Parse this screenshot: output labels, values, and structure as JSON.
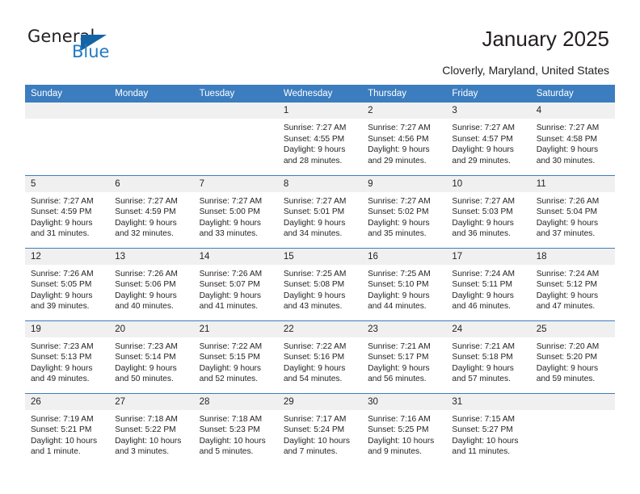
{
  "logo": {
    "word1": "General",
    "word2": "Blue",
    "triangle_color": "#1464a5",
    "blue_color": "#1f7ac4"
  },
  "header": {
    "title": "January 2025",
    "subtitle": "Cloverly, Maryland, United States"
  },
  "calendar": {
    "header_bg": "#3b7dbf",
    "daynum_bg": "#f0f0f0",
    "weekdays": [
      "Sunday",
      "Monday",
      "Tuesday",
      "Wednesday",
      "Thursday",
      "Friday",
      "Saturday"
    ],
    "weeks": [
      [
        {
          "day": "",
          "lines": []
        },
        {
          "day": "",
          "lines": []
        },
        {
          "day": "",
          "lines": []
        },
        {
          "day": "1",
          "lines": [
            "Sunrise: 7:27 AM",
            "Sunset: 4:55 PM",
            "Daylight: 9 hours",
            "and 28 minutes."
          ]
        },
        {
          "day": "2",
          "lines": [
            "Sunrise: 7:27 AM",
            "Sunset: 4:56 PM",
            "Daylight: 9 hours",
            "and 29 minutes."
          ]
        },
        {
          "day": "3",
          "lines": [
            "Sunrise: 7:27 AM",
            "Sunset: 4:57 PM",
            "Daylight: 9 hours",
            "and 29 minutes."
          ]
        },
        {
          "day": "4",
          "lines": [
            "Sunrise: 7:27 AM",
            "Sunset: 4:58 PM",
            "Daylight: 9 hours",
            "and 30 minutes."
          ]
        }
      ],
      [
        {
          "day": "5",
          "lines": [
            "Sunrise: 7:27 AM",
            "Sunset: 4:59 PM",
            "Daylight: 9 hours",
            "and 31 minutes."
          ]
        },
        {
          "day": "6",
          "lines": [
            "Sunrise: 7:27 AM",
            "Sunset: 4:59 PM",
            "Daylight: 9 hours",
            "and 32 minutes."
          ]
        },
        {
          "day": "7",
          "lines": [
            "Sunrise: 7:27 AM",
            "Sunset: 5:00 PM",
            "Daylight: 9 hours",
            "and 33 minutes."
          ]
        },
        {
          "day": "8",
          "lines": [
            "Sunrise: 7:27 AM",
            "Sunset: 5:01 PM",
            "Daylight: 9 hours",
            "and 34 minutes."
          ]
        },
        {
          "day": "9",
          "lines": [
            "Sunrise: 7:27 AM",
            "Sunset: 5:02 PM",
            "Daylight: 9 hours",
            "and 35 minutes."
          ]
        },
        {
          "day": "10",
          "lines": [
            "Sunrise: 7:27 AM",
            "Sunset: 5:03 PM",
            "Daylight: 9 hours",
            "and 36 minutes."
          ]
        },
        {
          "day": "11",
          "lines": [
            "Sunrise: 7:26 AM",
            "Sunset: 5:04 PM",
            "Daylight: 9 hours",
            "and 37 minutes."
          ]
        }
      ],
      [
        {
          "day": "12",
          "lines": [
            "Sunrise: 7:26 AM",
            "Sunset: 5:05 PM",
            "Daylight: 9 hours",
            "and 39 minutes."
          ]
        },
        {
          "day": "13",
          "lines": [
            "Sunrise: 7:26 AM",
            "Sunset: 5:06 PM",
            "Daylight: 9 hours",
            "and 40 minutes."
          ]
        },
        {
          "day": "14",
          "lines": [
            "Sunrise: 7:26 AM",
            "Sunset: 5:07 PM",
            "Daylight: 9 hours",
            "and 41 minutes."
          ]
        },
        {
          "day": "15",
          "lines": [
            "Sunrise: 7:25 AM",
            "Sunset: 5:08 PM",
            "Daylight: 9 hours",
            "and 43 minutes."
          ]
        },
        {
          "day": "16",
          "lines": [
            "Sunrise: 7:25 AM",
            "Sunset: 5:10 PM",
            "Daylight: 9 hours",
            "and 44 minutes."
          ]
        },
        {
          "day": "17",
          "lines": [
            "Sunrise: 7:24 AM",
            "Sunset: 5:11 PM",
            "Daylight: 9 hours",
            "and 46 minutes."
          ]
        },
        {
          "day": "18",
          "lines": [
            "Sunrise: 7:24 AM",
            "Sunset: 5:12 PM",
            "Daylight: 9 hours",
            "and 47 minutes."
          ]
        }
      ],
      [
        {
          "day": "19",
          "lines": [
            "Sunrise: 7:23 AM",
            "Sunset: 5:13 PM",
            "Daylight: 9 hours",
            "and 49 minutes."
          ]
        },
        {
          "day": "20",
          "lines": [
            "Sunrise: 7:23 AM",
            "Sunset: 5:14 PM",
            "Daylight: 9 hours",
            "and 50 minutes."
          ]
        },
        {
          "day": "21",
          "lines": [
            "Sunrise: 7:22 AM",
            "Sunset: 5:15 PM",
            "Daylight: 9 hours",
            "and 52 minutes."
          ]
        },
        {
          "day": "22",
          "lines": [
            "Sunrise: 7:22 AM",
            "Sunset: 5:16 PM",
            "Daylight: 9 hours",
            "and 54 minutes."
          ]
        },
        {
          "day": "23",
          "lines": [
            "Sunrise: 7:21 AM",
            "Sunset: 5:17 PM",
            "Daylight: 9 hours",
            "and 56 minutes."
          ]
        },
        {
          "day": "24",
          "lines": [
            "Sunrise: 7:21 AM",
            "Sunset: 5:18 PM",
            "Daylight: 9 hours",
            "and 57 minutes."
          ]
        },
        {
          "day": "25",
          "lines": [
            "Sunrise: 7:20 AM",
            "Sunset: 5:20 PM",
            "Daylight: 9 hours",
            "and 59 minutes."
          ]
        }
      ],
      [
        {
          "day": "26",
          "lines": [
            "Sunrise: 7:19 AM",
            "Sunset: 5:21 PM",
            "Daylight: 10 hours",
            "and 1 minute."
          ]
        },
        {
          "day": "27",
          "lines": [
            "Sunrise: 7:18 AM",
            "Sunset: 5:22 PM",
            "Daylight: 10 hours",
            "and 3 minutes."
          ]
        },
        {
          "day": "28",
          "lines": [
            "Sunrise: 7:18 AM",
            "Sunset: 5:23 PM",
            "Daylight: 10 hours",
            "and 5 minutes."
          ]
        },
        {
          "day": "29",
          "lines": [
            "Sunrise: 7:17 AM",
            "Sunset: 5:24 PM",
            "Daylight: 10 hours",
            "and 7 minutes."
          ]
        },
        {
          "day": "30",
          "lines": [
            "Sunrise: 7:16 AM",
            "Sunset: 5:25 PM",
            "Daylight: 10 hours",
            "and 9 minutes."
          ]
        },
        {
          "day": "31",
          "lines": [
            "Sunrise: 7:15 AM",
            "Sunset: 5:27 PM",
            "Daylight: 10 hours",
            "and 11 minutes."
          ]
        },
        {
          "day": "",
          "lines": []
        }
      ]
    ]
  }
}
